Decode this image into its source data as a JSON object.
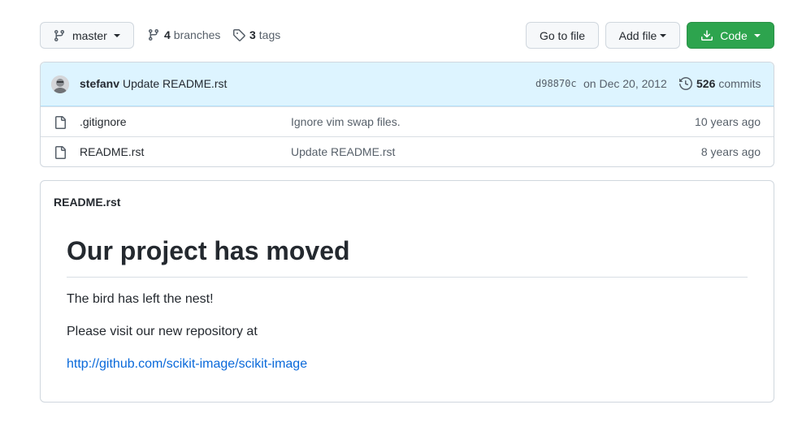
{
  "toolbar": {
    "branch_label": "master",
    "branches_count": "4",
    "branches_label": "branches",
    "tags_count": "3",
    "tags_label": "tags",
    "go_to_file_label": "Go to file",
    "add_file_label": "Add file",
    "code_label": "Code"
  },
  "commit": {
    "author": "stefanv",
    "message": "Update README.rst",
    "sha": "d98870c",
    "date": "on Dec 20, 2012",
    "commits_count": "526",
    "commits_label": "commits"
  },
  "files": [
    {
      "name": ".gitignore",
      "message": "Ignore vim swap files.",
      "age": "10 years ago"
    },
    {
      "name": "README.rst",
      "message": "Update README.rst",
      "age": "8 years ago"
    }
  ],
  "readme": {
    "filename": "README.rst",
    "heading": "Our project has moved",
    "para1": "The bird has left the nest!",
    "para2": "Please visit our new repository at",
    "link": "http://github.com/scikit-image/scikit-image"
  },
  "colors": {
    "code_button": "#2da44e",
    "link": "#0969da",
    "commit_bar": "#ddf4ff"
  }
}
